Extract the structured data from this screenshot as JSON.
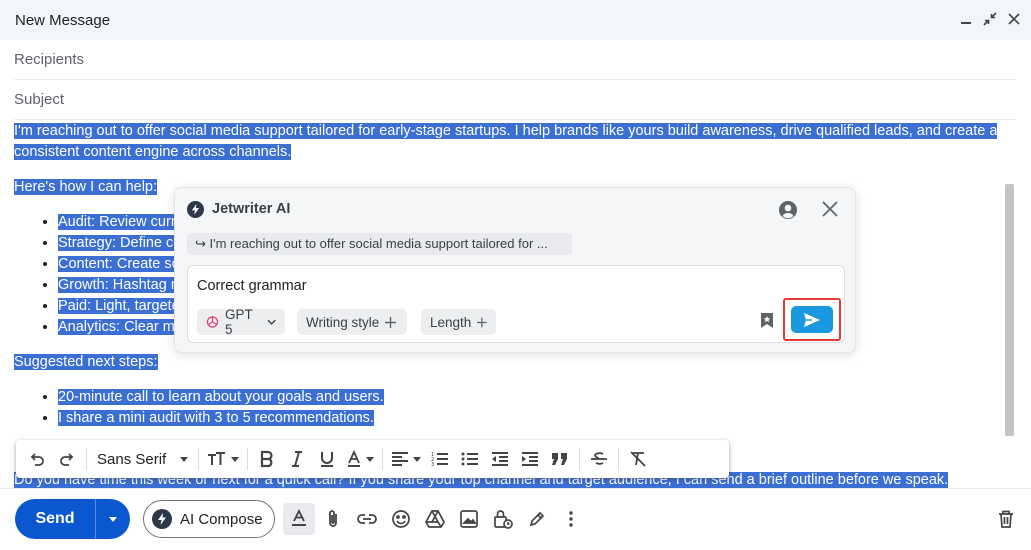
{
  "window": {
    "title": "New Message"
  },
  "fields": {
    "recipients": "Recipients",
    "subject": "Subject"
  },
  "body": {
    "intro": "I'm reaching out to offer social media support tailored for early-stage startups. I help brands like yours build awareness, drive qualified leads, and create a",
    "intro_cont": "consistent content engine across channels.",
    "help_heading": "Here's how I can help:",
    "help_items": [
      "Audit: Review curr",
      "Strategy: Define co",
      "Content: Create so",
      "Growth: Hashtag r",
      "Paid: Light, targete",
      "Analytics: Clear m"
    ],
    "next_heading": "Suggested next steps:",
    "next_items": [
      "20-minute call to learn about your goals and users.",
      "I share a mini audit with 3 to 5 recommendations."
    ],
    "closing": "Do you have time this week or next for a quick call? If you share your top channel and target audience, I can send a brief outline before we speak."
  },
  "format_toolbar": {
    "font": "Sans Serif"
  },
  "bottom_bar": {
    "send_label": "Send",
    "ai_compose_label": "AI Compose"
  },
  "jetwriter": {
    "title": "Jetwriter AI",
    "quote": "↪ I'm reaching out to offer social media support tailored for ...",
    "prompt": "Correct grammar",
    "model": "GPT 5",
    "writing_style": "Writing style",
    "length": "Length"
  },
  "colors": {
    "selection": "#3b6fd4",
    "send": "#0b57d0",
    "jw_send": "#1a98e0",
    "highlight_box": "#e53935"
  }
}
